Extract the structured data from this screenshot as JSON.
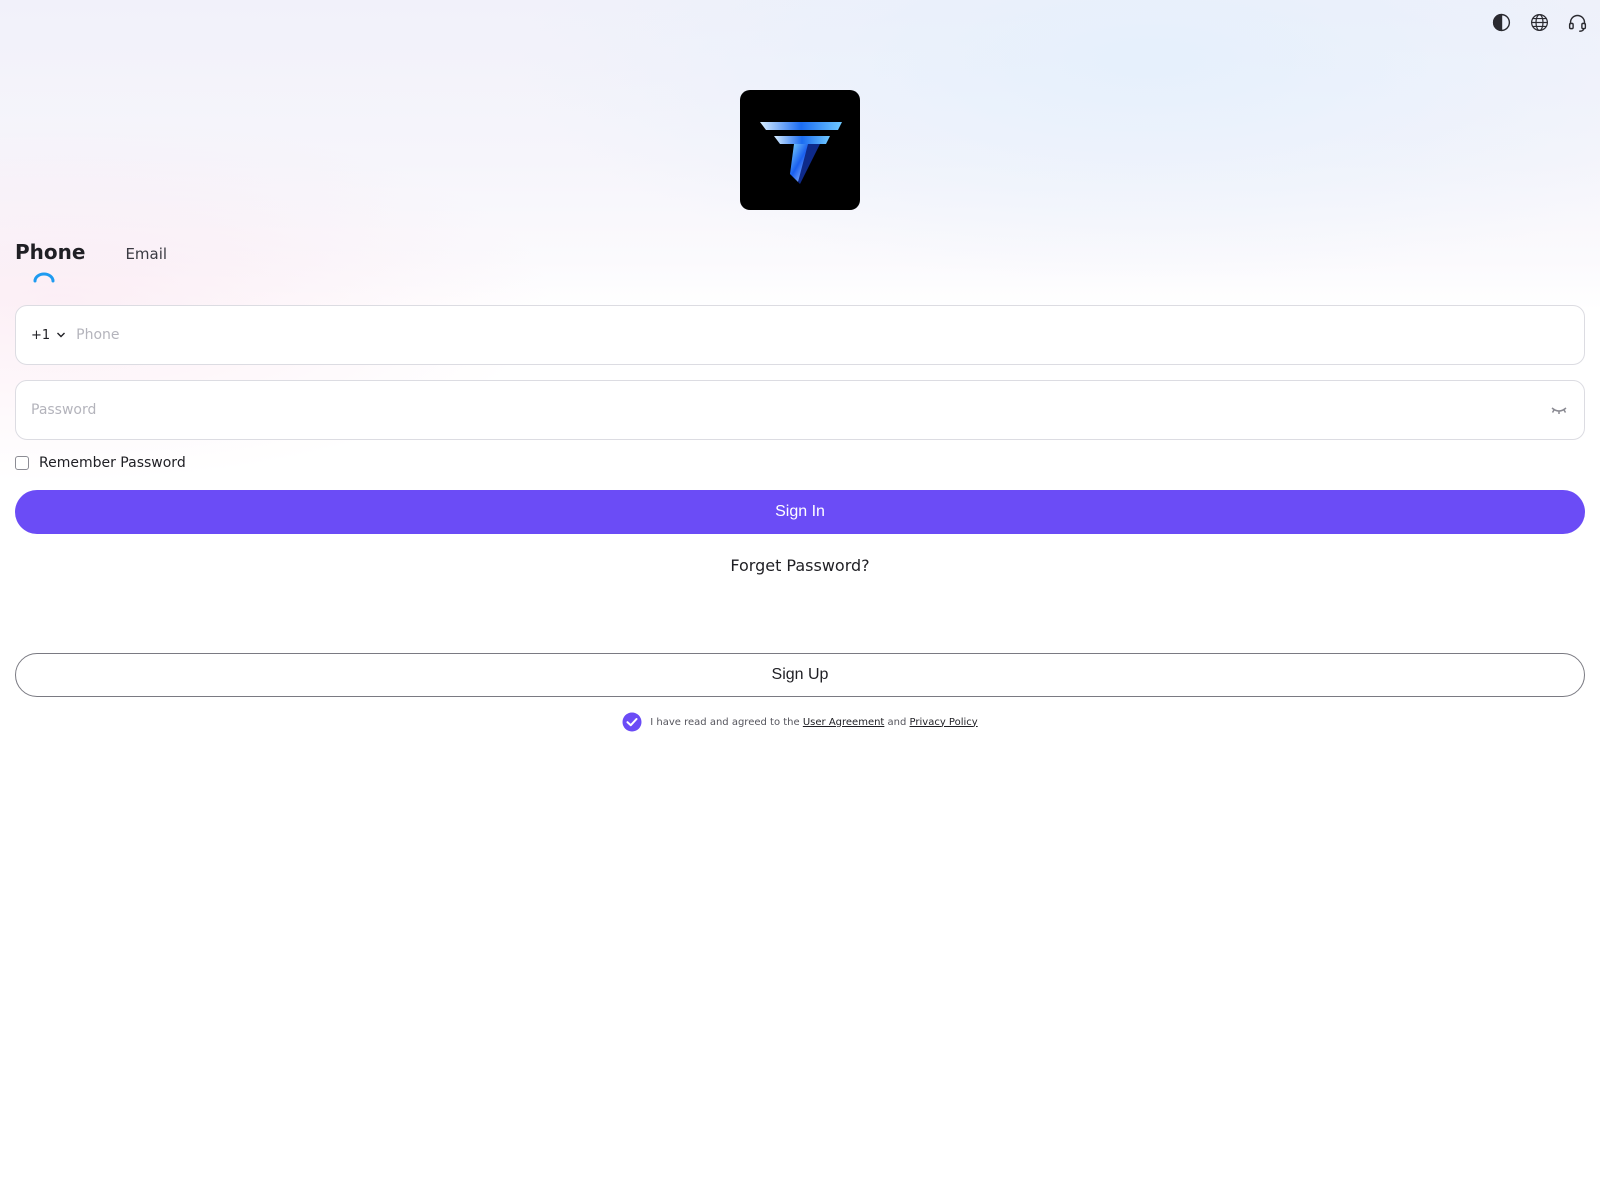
{
  "topbar": {
    "icons": [
      "theme-contrast-icon",
      "language-globe-icon",
      "support-headset-icon"
    ]
  },
  "logo": {
    "icon": "brand-t-logo-icon",
    "background": "#000000"
  },
  "tabs": [
    {
      "label": "Phone",
      "active": true
    },
    {
      "label": "Email",
      "active": false
    }
  ],
  "phone_field": {
    "country_code": "+1",
    "placeholder": "Phone",
    "value": ""
  },
  "password_field": {
    "placeholder": "Password",
    "value": ""
  },
  "remember": {
    "label": "Remember Password",
    "checked": false
  },
  "actions": {
    "sign_in": "Sign In",
    "forget_password": "Forget Password?",
    "sign_up": "Sign Up"
  },
  "agreement": {
    "checked": true,
    "prefix": "I have read and agreed to the ",
    "user_agreement": "User Agreement",
    "middle": " and ",
    "privacy_policy": "Privacy Policy"
  },
  "colors": {
    "accent": "#6b4cf6",
    "tab_indicator": "#1e9bf0",
    "text": "#1f1f24"
  }
}
